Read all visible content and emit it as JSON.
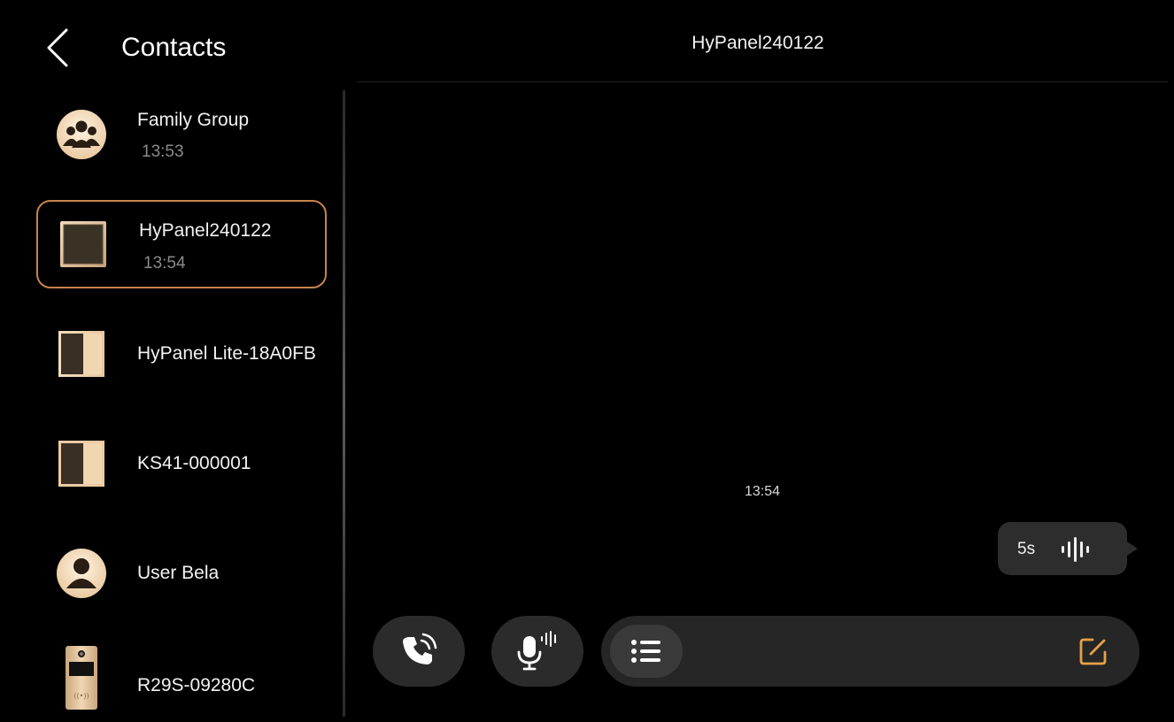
{
  "header": {
    "title": "Contacts",
    "back_icon": "chevron-left-icon"
  },
  "contacts": [
    {
      "name": "Family Group",
      "time": "13:53",
      "avatar": "group-icon",
      "selected": false
    },
    {
      "name": "HyPanel240122",
      "time": "13:54",
      "avatar": "panel-device-icon",
      "selected": true
    },
    {
      "name": "HyPanel Lite-18A0FB",
      "time": "",
      "avatar": "panel-device-icon",
      "selected": false
    },
    {
      "name": "KS41-000001",
      "time": "",
      "avatar": "panel-device-icon",
      "selected": false
    },
    {
      "name": "User Bela",
      "time": "",
      "avatar": "user-icon",
      "selected": false
    },
    {
      "name": "R29S-09280C",
      "time": "",
      "avatar": "doorbell-device-icon",
      "selected": false
    }
  ],
  "chat": {
    "title": "HyPanel240122",
    "message_time": "13:54",
    "voice_message": {
      "duration": "5s",
      "icon": "voice-wave-icon"
    }
  },
  "toolbar": {
    "call_icon": "phone-call-icon",
    "mic_icon": "microphone-icon",
    "list_icon": "list-icon",
    "edit_icon": "edit-icon"
  },
  "colors": {
    "accent": "#e8a04a",
    "selected_border": "#c9834a",
    "avatar_light": "#f7dfbd",
    "avatar_dark": "#3c2a18",
    "button_bg": "#2b2b2b"
  }
}
